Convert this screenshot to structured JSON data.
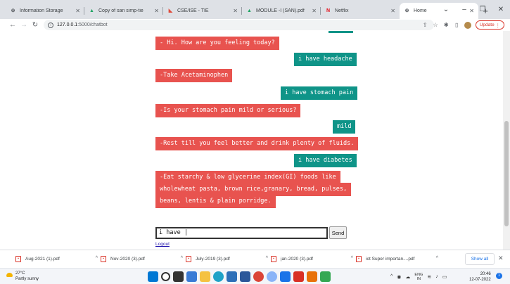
{
  "browser": {
    "tabs": [
      {
        "title": "Information Storage",
        "favicon_color": "#5f6368",
        "favicon": "⊕"
      },
      {
        "title": "Copy of san simp-tie",
        "favicon_color": "#1fa463",
        "favicon": "▲"
      },
      {
        "title": "CSE/ISE - TIE",
        "favicon_color": "#e04a3a",
        "favicon": "◣"
      },
      {
        "title": "MODULE -I (SAN).pdf",
        "favicon_color": "#1fa463",
        "favicon": "▲"
      },
      {
        "title": "Netflix",
        "favicon_color": "#e50914",
        "favicon": "N"
      },
      {
        "title": "Home",
        "favicon_color": "#5f6368",
        "favicon": "⊕"
      }
    ],
    "new_tab_symbol": "+",
    "window_controls": {
      "menu": "⌄",
      "minimize": "–",
      "restore": "❐",
      "close": "✕"
    },
    "address": {
      "host": "127.0.0.1",
      "path": ":5000/chatbot"
    },
    "update_label": "Update"
  },
  "chat": {
    "messages": [
      {
        "from": "user",
        "text": ""
      },
      {
        "from": "bot",
        "text": "- Hi. How are you feeling today?"
      },
      {
        "from": "user",
        "text": "i have headache"
      },
      {
        "from": "bot",
        "text": "-Take Acetaminophen"
      },
      {
        "from": "user",
        "text": "i have stomach pain"
      },
      {
        "from": "bot",
        "text": "-Is your stomach pain mild or serious?"
      },
      {
        "from": "user",
        "text": "mild"
      },
      {
        "from": "bot",
        "text": "-Rest till you feel better and drink plenty of fluids."
      },
      {
        "from": "user",
        "text": "i have diabetes"
      },
      {
        "from": "bot",
        "lines": [
          "-Eat starchy & low glycerine index(GI) foods like",
          "wholewheat pasta, brown rice,granary, bread, pulses,",
          "beans, lentis & plain porridge."
        ]
      }
    ],
    "input_value": "i have ",
    "send_label": "Send",
    "logout_label": "Logout",
    "colors": {
      "bot": "#e8534f",
      "user": "#0f9488"
    }
  },
  "downloads": {
    "items": [
      "Aug-2021 (1).pdf",
      "Nov-2020 (3).pdf",
      "July-2019 (3).pdf",
      "jan-2020 (3).pdf",
      "iot Super importan....pdf"
    ],
    "show_all_label": "Show all"
  },
  "taskbar": {
    "weather_temp": "27°C",
    "weather_desc": "Partly sunny",
    "lang_line1": "ENG",
    "lang_line2": "IN",
    "time": "20:46",
    "date": "12-07-2022",
    "notification_count": "1"
  }
}
